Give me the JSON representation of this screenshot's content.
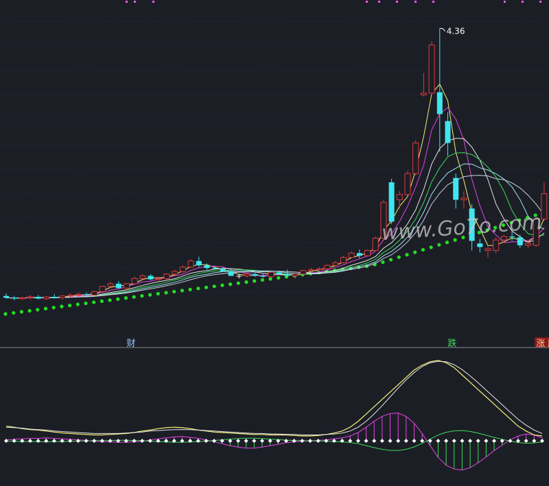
{
  "colors": {
    "background": "#1c1e26",
    "grid": "#2e3444",
    "divider": "#8a8a8a",
    "up": "#e03a3a",
    "down": "#3fe6ee",
    "doji": "#ffffff",
    "ma_yellow": "#f5f27a",
    "ma_magenta": "#e445e4",
    "ma_white": "#e9e9e9",
    "ma_green": "#3ddc5a",
    "ma_cyan": "#9ee8f2",
    "ma_slate": "#c7d3e2",
    "support": "#22e022",
    "osc_pos": "#e445e4",
    "osc_neg": "#3ddc5a",
    "osc_marker": "#ffffff",
    "marker_accent": "#ff55ff",
    "label_cai": "#9ec8ff",
    "label_die": "#3ddc5a",
    "label_zhangteng": "#ffcc99",
    "label_zhangteng_bg": "#8a1a1a",
    "peak_label": "#ffffff",
    "watermark": "#c9c9c9"
  },
  "watermark": "www.Go7o.com",
  "top_markers": 11,
  "chart_data": {
    "type": "candlestick",
    "candles": [
      [
        1.3,
        1.33,
        1.27,
        1.28
      ],
      [
        1.28,
        1.3,
        1.25,
        1.27
      ],
      [
        1.27,
        1.29,
        1.25,
        1.28
      ],
      [
        1.28,
        1.31,
        1.26,
        1.29
      ],
      [
        1.29,
        1.31,
        1.26,
        1.27
      ],
      [
        1.27,
        1.3,
        1.25,
        1.29
      ],
      [
        1.29,
        1.32,
        1.27,
        1.28
      ],
      [
        1.28,
        1.31,
        1.26,
        1.3
      ],
      [
        1.3,
        1.33,
        1.28,
        1.31
      ],
      [
        1.31,
        1.34,
        1.29,
        1.32
      ],
      [
        1.32,
        1.34,
        1.3,
        1.31
      ],
      [
        1.31,
        1.36,
        1.3,
        1.35
      ],
      [
        1.35,
        1.42,
        1.34,
        1.41
      ],
      [
        1.41,
        1.46,
        1.39,
        1.44
      ],
      [
        1.44,
        1.47,
        1.38,
        1.39
      ],
      [
        1.39,
        1.45,
        1.37,
        1.44
      ],
      [
        1.44,
        1.52,
        1.43,
        1.5
      ],
      [
        1.5,
        1.55,
        1.48,
        1.53
      ],
      [
        1.53,
        1.55,
        1.48,
        1.49
      ],
      [
        1.49,
        1.52,
        1.47,
        1.5
      ],
      [
        1.5,
        1.56,
        1.48,
        1.55
      ],
      [
        1.55,
        1.6,
        1.53,
        1.58
      ],
      [
        1.58,
        1.65,
        1.56,
        1.63
      ],
      [
        1.63,
        1.72,
        1.62,
        1.7
      ],
      [
        1.7,
        1.75,
        1.63,
        1.65
      ],
      [
        1.65,
        1.67,
        1.6,
        1.62
      ],
      [
        1.62,
        1.64,
        1.6,
        1.61
      ],
      [
        1.61,
        1.63,
        1.58,
        1.58
      ],
      [
        1.58,
        1.61,
        1.55,
        1.53
      ],
      [
        1.53,
        1.55,
        1.5,
        1.53
      ],
      [
        1.53,
        1.56,
        1.51,
        1.55
      ],
      [
        1.55,
        1.57,
        1.52,
        1.53
      ],
      [
        1.53,
        1.55,
        1.51,
        1.52
      ],
      [
        1.52,
        1.58,
        1.51,
        1.57
      ],
      [
        1.57,
        1.59,
        1.54,
        1.55
      ],
      [
        1.55,
        1.6,
        1.52,
        1.53
      ],
      [
        1.53,
        1.56,
        1.5,
        1.55
      ],
      [
        1.55,
        1.6,
        1.54,
        1.59
      ],
      [
        1.59,
        1.62,
        1.57,
        1.6
      ],
      [
        1.6,
        1.63,
        1.58,
        1.61
      ],
      [
        1.61,
        1.66,
        1.6,
        1.65
      ],
      [
        1.65,
        1.7,
        1.64,
        1.68
      ],
      [
        1.68,
        1.76,
        1.67,
        1.74
      ],
      [
        1.74,
        1.81,
        1.73,
        1.79
      ],
      [
        1.79,
        1.83,
        1.73,
        1.76
      ],
      [
        1.76,
        1.83,
        1.75,
        1.82
      ],
      [
        1.82,
        1.98,
        1.81,
        1.96
      ],
      [
        1.96,
        2.4,
        1.94,
        2.37
      ],
      [
        2.6,
        2.64,
        2.12,
        2.15
      ],
      [
        2.4,
        2.5,
        2.3,
        2.46
      ],
      [
        2.46,
        2.73,
        2.45,
        2.7
      ],
      [
        2.7,
        3.08,
        2.68,
        3.05
      ],
      [
        3.6,
        3.85,
        3.58,
        3.62
      ],
      [
        3.62,
        4.21,
        3.6,
        4.17
      ],
      [
        3.63,
        4.36,
        2.95,
        3.38
      ],
      [
        3.3,
        3.4,
        2.9,
        3.05
      ],
      [
        2.65,
        2.7,
        2.3,
        2.4
      ],
      [
        2.4,
        2.5,
        2.3,
        2.42
      ],
      [
        2.3,
        2.35,
        1.82,
        1.93
      ],
      [
        1.9,
        1.95,
        1.8,
        1.86
      ],
      [
        1.82,
        1.86,
        1.74,
        1.84
      ],
      [
        1.82,
        1.97,
        1.79,
        1.94
      ],
      [
        1.94,
        2.0,
        1.9,
        1.98
      ],
      [
        1.98,
        2.04,
        1.93,
        1.97
      ],
      [
        1.97,
        2.0,
        1.85,
        1.88
      ],
      [
        1.88,
        1.93,
        1.85,
        1.9
      ],
      [
        1.88,
        2.2,
        1.86,
        2.18
      ],
      [
        2.18,
        2.6,
        2.16,
        2.47
      ]
    ],
    "ma_series": [
      {
        "color": "#f5f27a",
        "period": 3
      },
      {
        "color": "#e445e4",
        "period": 5
      },
      {
        "color": "#e9e9e9",
        "period": 8
      },
      {
        "color": "#3ddc5a",
        "period": 10
      },
      {
        "color": "#9ee8f2",
        "period": 12
      },
      {
        "color": "#c7d3e2",
        "period": 14
      }
    ],
    "peak_value": "4.36",
    "signals": [
      {
        "index": 15,
        "text": "财"
      },
      {
        "index": 55,
        "text": "跌"
      },
      {
        "index": 66,
        "text": "涨",
        "text2": "腾"
      }
    ],
    "oscillator": {
      "zero_line": 0,
      "line_yellow": [
        0.3,
        0.28,
        0.25,
        0.23,
        0.22,
        0.2,
        0.18,
        0.16,
        0.15,
        0.14,
        0.13,
        0.12,
        0.12,
        0.13,
        0.14,
        0.15,
        0.17,
        0.2,
        0.22,
        0.25,
        0.27,
        0.28,
        0.27,
        0.25,
        0.22,
        0.2,
        0.18,
        0.17,
        0.16,
        0.15,
        0.14,
        0.13,
        0.13,
        0.12,
        0.12,
        0.12,
        0.11,
        0.1,
        0.1,
        0.11,
        0.13,
        0.16,
        0.2,
        0.28,
        0.4,
        0.55,
        0.7,
        0.85,
        1.0,
        1.15,
        1.3,
        1.45,
        1.55,
        1.62,
        1.65,
        1.6,
        1.5,
        1.35,
        1.2,
        1.05,
        0.9,
        0.75,
        0.6,
        0.45,
        0.3,
        0.2,
        0.12,
        0.1
      ],
      "line_signal": [
        0.28,
        0.27,
        0.26,
        0.24,
        0.23,
        0.22,
        0.2,
        0.19,
        0.18,
        0.17,
        0.16,
        0.15,
        0.15,
        0.15,
        0.15,
        0.16,
        0.17,
        0.18,
        0.2,
        0.21,
        0.22,
        0.23,
        0.23,
        0.23,
        0.22,
        0.21,
        0.2,
        0.19,
        0.18,
        0.17,
        0.16,
        0.15,
        0.15,
        0.14,
        0.14,
        0.13,
        0.13,
        0.12,
        0.12,
        0.12,
        0.13,
        0.14,
        0.16,
        0.2,
        0.28,
        0.4,
        0.55,
        0.72,
        0.9,
        1.08,
        1.25,
        1.4,
        1.52,
        1.6,
        1.63,
        1.62,
        1.56,
        1.46,
        1.33,
        1.19,
        1.04,
        0.89,
        0.74,
        0.59,
        0.44,
        0.32,
        0.22,
        0.15
      ],
      "histogram": [
        0.02,
        0.03,
        0.04,
        0.05,
        0.05,
        0.06,
        0.05,
        0.04,
        0.03,
        0.02,
        0.01,
        -0.01,
        -0.02,
        -0.02,
        -0.03,
        -0.03,
        -0.02,
        -0.01,
        0.02,
        0.04,
        0.06,
        0.08,
        0.09,
        0.07,
        0.05,
        0.02,
        -0.02,
        -0.06,
        -0.1,
        -0.13,
        -0.15,
        -0.15,
        -0.13,
        -0.1,
        -0.07,
        -0.04,
        -0.02,
        -0.01,
        0.0,
        0.01,
        0.02,
        0.04,
        0.06,
        0.1,
        0.17,
        0.28,
        0.4,
        0.5,
        0.56,
        0.57,
        0.5,
        0.36,
        0.15,
        -0.1,
        -0.34,
        -0.5,
        -0.58,
        -0.6,
        -0.55,
        -0.45,
        -0.33,
        -0.2,
        -0.09,
        0.02,
        0.1,
        0.14,
        0.12,
        0.06
      ],
      "ylim": [
        -0.8,
        1.8
      ]
    },
    "support_dots": 68,
    "ylim": [
      1.0,
      4.45
    ]
  }
}
